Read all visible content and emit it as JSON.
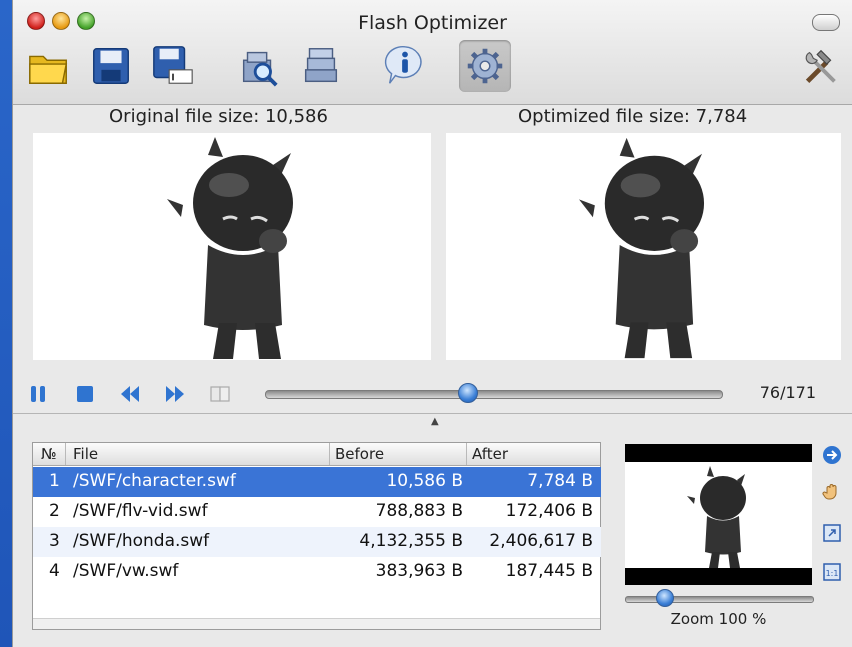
{
  "window": {
    "title": "Flash Optimizer"
  },
  "toolbar": {
    "icons": [
      "open-folder-icon",
      "save-icon",
      "save-as-icon",
      "inspect-icon",
      "stack-icon",
      "info-icon",
      "settings-gear-icon",
      "tools-icon"
    ]
  },
  "preview": {
    "original_label": "Original file size: 10,586",
    "optimized_label": "Optimized file size: 7,784"
  },
  "playback": {
    "progress": 0.44,
    "frame_counter": "76/171"
  },
  "table": {
    "columns": [
      "№",
      "File",
      "Before",
      "After"
    ],
    "rows": [
      {
        "num": "1",
        "file": "/SWF/character.swf",
        "before": "10,586 B",
        "after": "7,784 B",
        "selected": true
      },
      {
        "num": "2",
        "file": "/SWF/flv-vid.swf",
        "before": "788,883 B",
        "after": "172,406 B"
      },
      {
        "num": "3",
        "file": "/SWF/honda.swf",
        "before": "4,132,355 B",
        "after": "2,406,617 B"
      },
      {
        "num": "4",
        "file": "/SWF/vw.swf",
        "before": "383,963 B",
        "after": "187,445 B"
      }
    ]
  },
  "zoom": {
    "label": "Zoom 100 %"
  },
  "colors": {
    "selection": "#3a74d6",
    "accent": "#3b7fd6"
  }
}
